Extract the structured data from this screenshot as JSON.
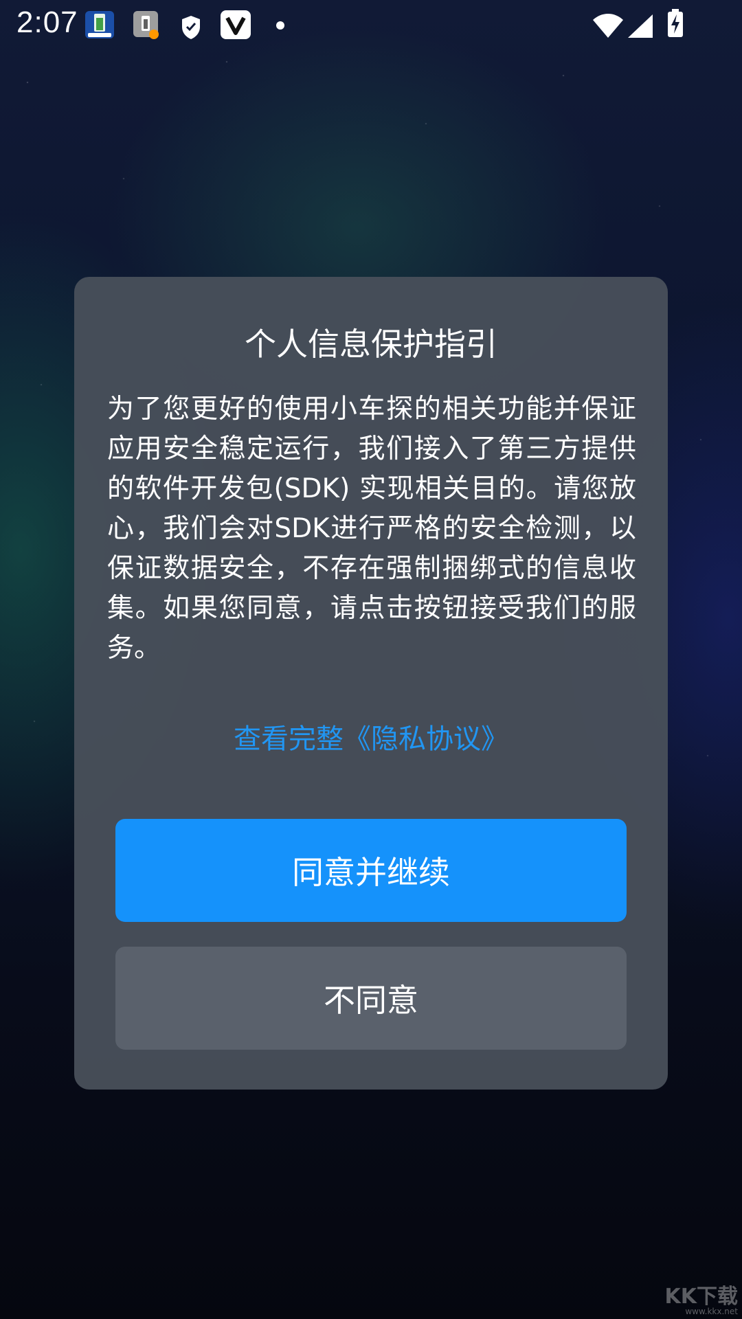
{
  "status_bar": {
    "time": "2:07",
    "icons": [
      "battery-app-icon",
      "battery-alert-icon",
      "shield-icon",
      "v-app-icon",
      "notification-dot-icon",
      "wifi-icon",
      "signal-icon",
      "battery-charging-icon"
    ]
  },
  "dialog": {
    "title": "个人信息保护指引",
    "body": "为了您更好的使用小车探的相关功能并保证应用安全稳定运行，我们接入了第三方提供的软件开发包(SDK) 实现相关目的。请您放心，我们会对SDK进行严格的安全检测，以保证数据安全，不存在强制捆绑式的信息收集。如果您同意，请点击按钮接受我们的服务。",
    "privacy_link": "查看完整《隐私协议》",
    "agree_label": "同意并继续",
    "disagree_label": "不同意"
  },
  "watermark": {
    "text": "KK下载",
    "url": "www.kkx.net"
  },
  "colors": {
    "accent": "#1592fb",
    "link": "#2196f3",
    "dialog_bg": "#484f5a",
    "secondary_button": "#5a616c"
  }
}
